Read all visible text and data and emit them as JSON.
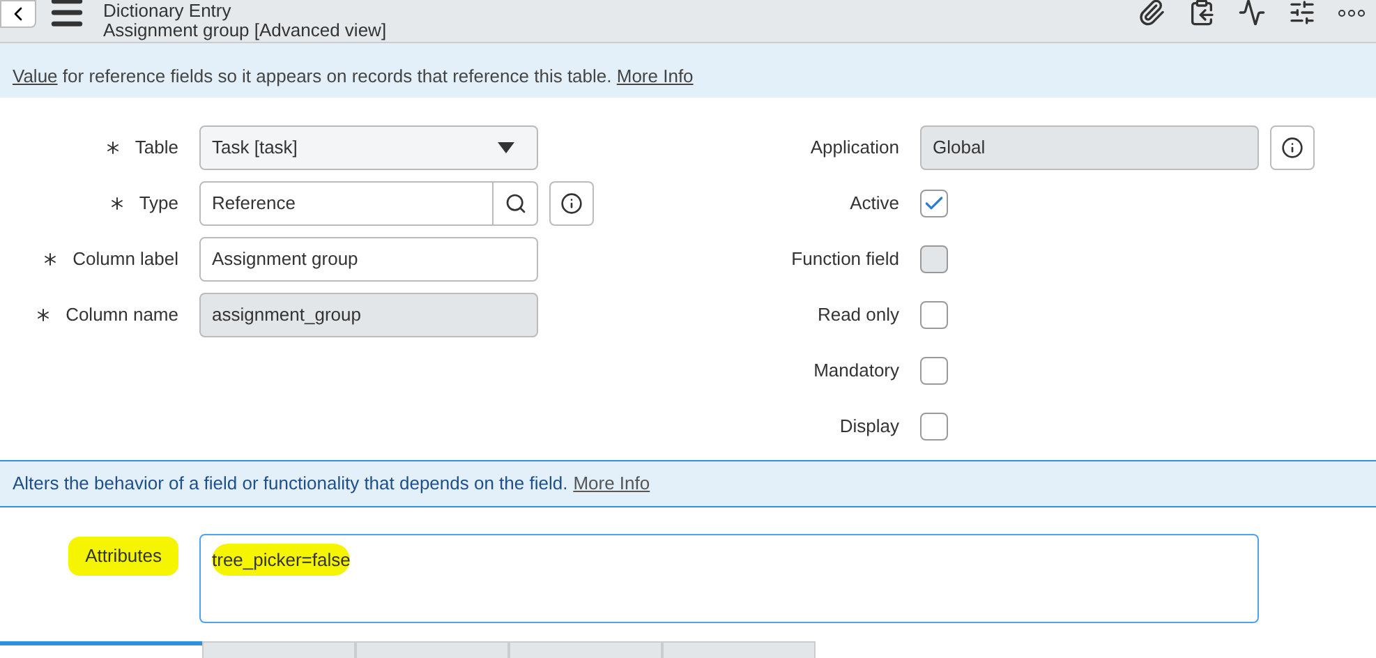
{
  "header": {
    "title": "Dictionary Entry",
    "subtitle": "Assignment group [Advanced view]"
  },
  "info_banner": {
    "link": "Value",
    "text": "for reference fields so it appears on records that reference this table.",
    "more": "More Info"
  },
  "left_fields": [
    {
      "label": "Table",
      "required": true,
      "kind": "select",
      "value": "Task [task]"
    },
    {
      "label": "Type",
      "required": true,
      "kind": "reference",
      "value": "Reference"
    },
    {
      "label": "Column label",
      "required": true,
      "kind": "text",
      "value": "Assignment group"
    },
    {
      "label": "Column name",
      "required": true,
      "kind": "readonly",
      "value": "assignment_group"
    }
  ],
  "right_fields": [
    {
      "label": "Application",
      "kind": "readonly",
      "value": "Global"
    },
    {
      "label": "Active",
      "kind": "checkbox",
      "checked": true,
      "disabled": false
    },
    {
      "label": "Function field",
      "kind": "checkbox",
      "checked": false,
      "disabled": true
    },
    {
      "label": "Read only",
      "kind": "checkbox",
      "checked": false,
      "disabled": false
    },
    {
      "label": "Mandatory",
      "kind": "checkbox",
      "checked": false,
      "disabled": false
    },
    {
      "label": "Display",
      "kind": "checkbox",
      "checked": false,
      "disabled": false
    }
  ],
  "attributes_banner": {
    "text": "Alters the behavior of a field or functionality that depends on the field.",
    "more": "More Info"
  },
  "attributes": {
    "label": "Attributes",
    "value": "tree_picker=false",
    "highlighted": true
  },
  "tabs": [
    {
      "selected": true
    },
    {
      "selected": false
    },
    {
      "selected": false
    },
    {
      "selected": false
    },
    {
      "selected": false
    }
  ]
}
